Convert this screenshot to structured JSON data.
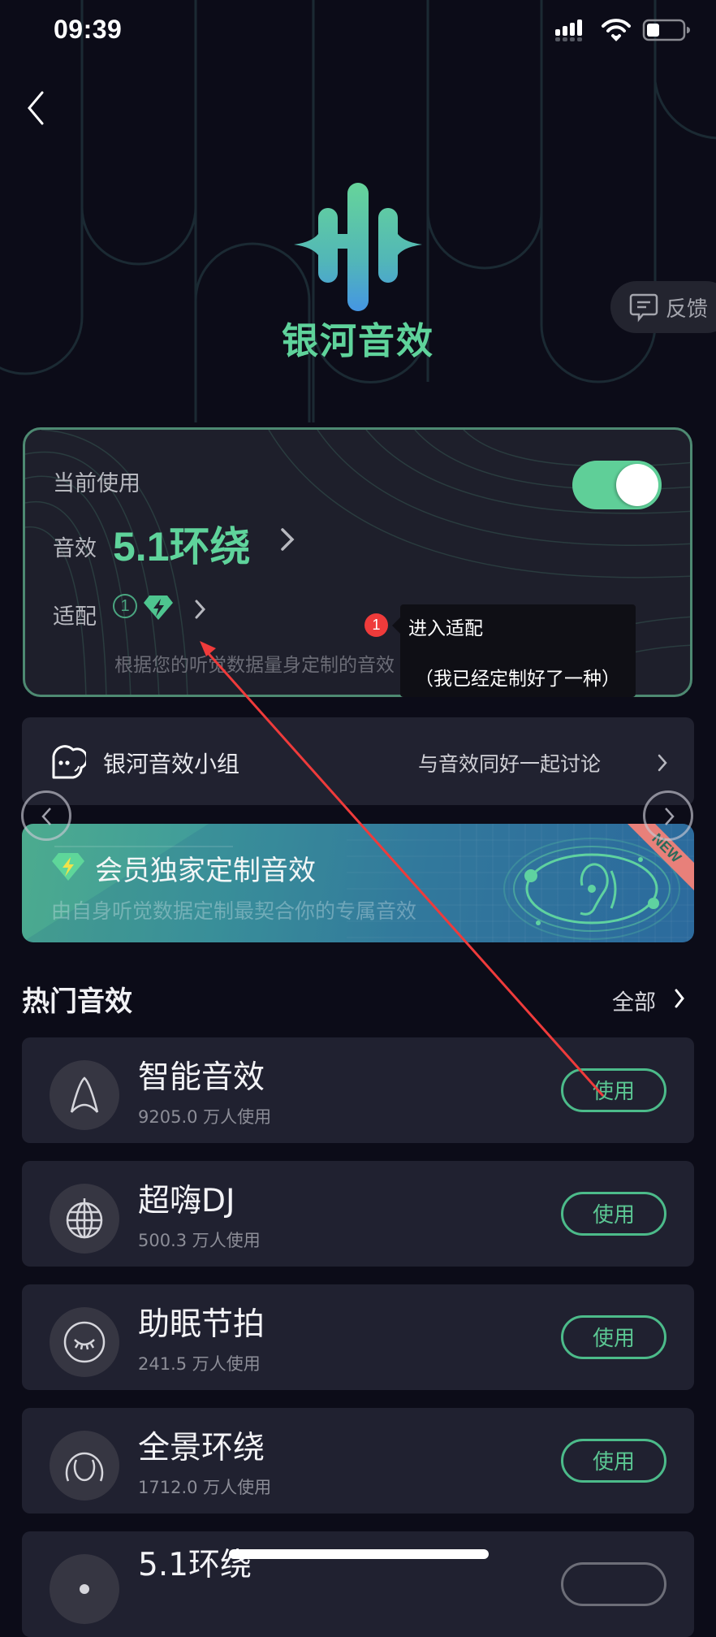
{
  "status_bar": {
    "time": "09:39",
    "battery_level": 0.3
  },
  "header": {
    "back_icon": "chevron-left-icon",
    "app_name": "银河音效",
    "feedback_label": "反馈",
    "feedback_icon": "chat-bubble-icon"
  },
  "current_card": {
    "current_label": "当前使用",
    "toggle_on": true,
    "effect_label": "音效",
    "effect_value": "5.1环绕",
    "adapt_label": "适配",
    "adapt_count": "1",
    "adapt_icon": "vip-gem-icon",
    "adapt_description": "根据您的听觉数据量身定制的音效"
  },
  "annotation": {
    "badge": "1",
    "title": "进入适配",
    "note": "（我已经定制好了一种）",
    "color": "#ef3b3b"
  },
  "group": {
    "title": "银河音效小组",
    "subtitle": "与音效同好一起讨论"
  },
  "banner": {
    "title": "会员独家定制音效",
    "subtitle": "由自身听觉数据定制最契合你的专属音效",
    "ribbon": "NEW"
  },
  "hot_section": {
    "title": "热门音效",
    "see_all": "全部",
    "items": [
      {
        "title": "智能音效",
        "count": "9205.0 万人使用",
        "icon": "letter-a-icon",
        "button": "使用"
      },
      {
        "title": "超嗨DJ",
        "count": "500.3 万人使用",
        "icon": "disco-ball-icon",
        "button": "使用"
      },
      {
        "title": "助眠节拍",
        "count": "241.5 万人使用",
        "icon": "sleep-eye-icon",
        "button": "使用"
      },
      {
        "title": "全景环绕",
        "count": "1712.0 万人使用",
        "icon": "surround-arcs-icon",
        "button": "使用"
      },
      {
        "title": "5.1环绕",
        "count": "",
        "icon": "surround-51-icon",
        "button": ""
      }
    ]
  },
  "colors": {
    "accent": "#5fd39b",
    "background": "#0c0c18",
    "card": "#202130"
  }
}
